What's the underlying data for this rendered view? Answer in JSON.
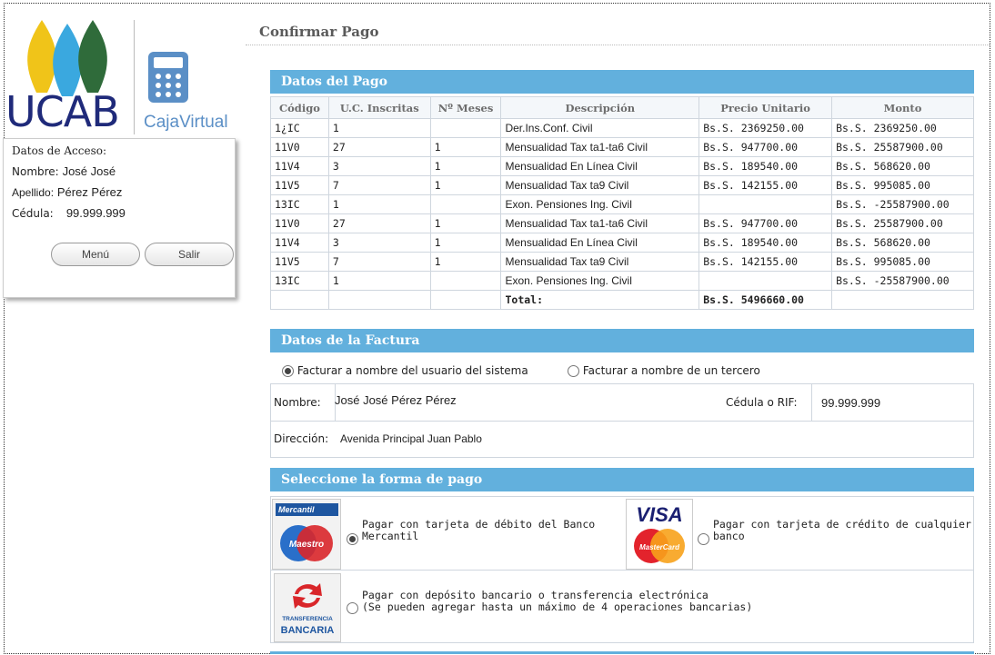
{
  "brand": {
    "logo_text": "UCAB",
    "product": "CajaVirtual"
  },
  "access": {
    "title": "Datos de Acceso:",
    "nombre_label": "Nombre:",
    "nombre": "José José",
    "apellido_label": "Apellido:",
    "apellido": "Pérez Pérez",
    "cedula_label": "Cédula:",
    "cedula": "99.999.999",
    "menu_button": "Menú",
    "exit_button": "Salir"
  },
  "page_title": "Confirmar Pago",
  "sections": {
    "payment_data": "Datos del Pago",
    "invoice_data": "Datos de la Factura",
    "payment_method": "Seleccione la forma de pago"
  },
  "payments_table": {
    "headers": [
      "Código",
      "U.C. Inscritas",
      "Nº Meses",
      "Descripción",
      "Precio Unitario",
      "Monto"
    ],
    "rows": [
      [
        "1¿IC",
        "1",
        "",
        "Der.Ins.Conf. Civil",
        "Bs.S. 2369250.00",
        "Bs.S. 2369250.00"
      ],
      [
        "11V0",
        "27",
        "1",
        "Mensualidad Tax ta1-ta6 Civil",
        "Bs.S. 947700.00",
        "Bs.S. 25587900.00"
      ],
      [
        "11V4",
        "3",
        "1",
        "Mensualidad En Línea Civil",
        "Bs.S. 189540.00",
        "Bs.S. 568620.00"
      ],
      [
        "11V5",
        "7",
        "1",
        "Mensualidad Tax ta9 Civil",
        "Bs.S. 142155.00",
        "Bs.S. 995085.00"
      ],
      [
        "13IC",
        "1",
        "",
        "Exon. Pensiones Ing. Civil",
        "",
        "Bs.S. -25587900.00"
      ],
      [
        "11V0",
        "27",
        "1",
        "Mensualidad Tax ta1-ta6 Civil",
        "Bs.S. 947700.00",
        "Bs.S. 25587900.00"
      ],
      [
        "11V4",
        "3",
        "1",
        "Mensualidad En Línea Civil",
        "Bs.S. 189540.00",
        "Bs.S. 568620.00"
      ],
      [
        "11V5",
        "7",
        "1",
        "Mensualidad Tax ta9 Civil",
        "Bs.S. 142155.00",
        "Bs.S. 995085.00"
      ],
      [
        "13IC",
        "1",
        "",
        "Exon. Pensiones Ing. Civil",
        "",
        "Bs.S. -25587900.00"
      ]
    ],
    "total_label": "Total:",
    "total_value": "Bs.S. 5496660.00"
  },
  "invoice": {
    "option_self": "Facturar a nombre del usuario del sistema",
    "option_third": "Facturar a nombre de un tercero",
    "selected": "self",
    "nombre_label": "Nombre:",
    "nombre": "José José Pérez Pérez",
    "cedula_label": "Cédula o RIF:",
    "cedula": "99.999.999",
    "direccion_label": "Dirección:",
    "direccion": "Avenida Principal Juan Pablo"
  },
  "payment_methods": {
    "debit_mercantil": "Pagar con tarjeta de débito del Banco Mercantil",
    "debit_line1": "Pagar con tarjeta de débito del Banco",
    "debit_line2": "Mercantil",
    "credit_line1": "Pagar con tarjeta de crédito de cualquier",
    "credit_line2": "banco",
    "transfer_line1": "Pagar con depósito bancario o transferencia electrónica",
    "transfer_line2": "(Se pueden agregar hasta un máximo de 4 operaciones bancarias)",
    "selected": "debit_mercantil",
    "logos": {
      "mercantil": "Mercantil",
      "maestro": "Maestro",
      "visa": "VISA",
      "mastercard": "MasterCard",
      "transfer_top": "TRANSFERENCIA",
      "transfer_bottom": "BANCARIA"
    }
  },
  "colors": {
    "section_bar": "#62b0dd",
    "brand_navy": "#1f2a7a",
    "brand_light": "#5b8fc6"
  }
}
